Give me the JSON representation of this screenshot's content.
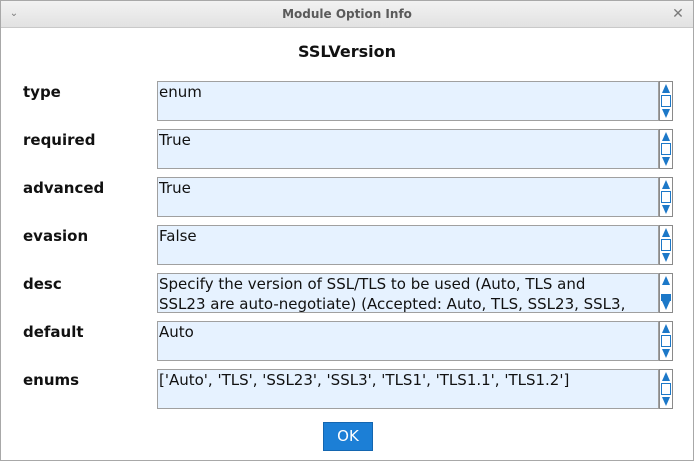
{
  "window": {
    "title": "Module Option Info",
    "minimize_glyph": "⌄",
    "close_glyph": "✕"
  },
  "option_name": "SSLVersion",
  "rows": [
    {
      "label": "type",
      "value": "enum"
    },
    {
      "label": "required",
      "value": "True"
    },
    {
      "label": "advanced",
      "value": "True"
    },
    {
      "label": "evasion",
      "value": "False"
    },
    {
      "label": "desc",
      "value": "Specify the version of SSL/TLS to be used (Auto, TLS and\nSSL23 are auto-negotiate) (Accepted: Auto, TLS, SSL23, SSL3,"
    },
    {
      "label": "default",
      "value": "Auto"
    },
    {
      "label": "enums",
      "value": "['Auto', 'TLS', 'SSL23', 'SSL3', 'TLS1', 'TLS1.1', 'TLS1.2']"
    }
  ],
  "ok_label": "OK",
  "colors": {
    "accent": "#1c7fd6",
    "field_bg": "#e6f2ff"
  },
  "icons": {
    "minimize": "chevron-down-icon",
    "close": "close-icon",
    "scroll_up": "arrow-up-icon",
    "scroll_down": "arrow-down-icon"
  }
}
